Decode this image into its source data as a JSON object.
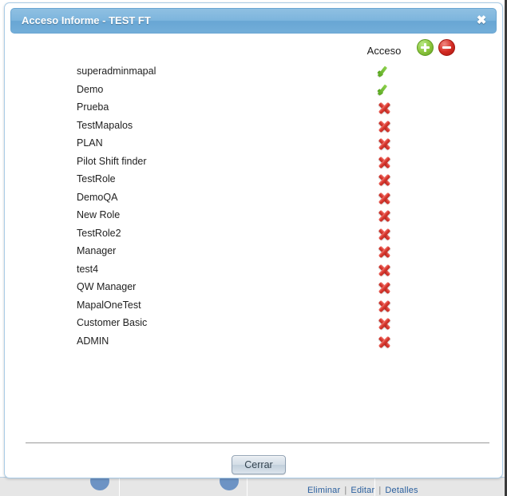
{
  "dialog": {
    "title": "Acceso Informe - TEST FT",
    "close_icon": "close-icon",
    "close_glyph": "✖"
  },
  "header": {
    "access_column_label": "Acceso",
    "add_icon": "add-circle-icon",
    "remove_icon": "remove-circle-icon"
  },
  "colors": {
    "titlebar_top": "#8fc0e2",
    "titlebar_bottom": "#73aed9",
    "dialog_border": "#a9cbe6",
    "granted_green": "#5aa820",
    "denied_red": "#dc3c33",
    "add_green": "#8dc63f",
    "remove_red": "#d42b23",
    "text": "#1f1f1f",
    "link_blue": "#2a5f9e"
  },
  "roles": [
    {
      "name": "superadminmapal",
      "access": "granted"
    },
    {
      "name": "Demo",
      "access": "granted"
    },
    {
      "name": "Prueba",
      "access": "denied"
    },
    {
      "name": "TestMapalos",
      "access": "denied"
    },
    {
      "name": "PLAN",
      "access": "denied"
    },
    {
      "name": "Pilot Shift finder",
      "access": "denied"
    },
    {
      "name": "TestRole",
      "access": "denied"
    },
    {
      "name": "DemoQA",
      "access": "denied"
    },
    {
      "name": "New Role",
      "access": "denied"
    },
    {
      "name": "TestRole2",
      "access": "denied"
    },
    {
      "name": "Manager",
      "access": "denied"
    },
    {
      "name": "test4",
      "access": "denied"
    },
    {
      "name": "QW Manager",
      "access": "denied"
    },
    {
      "name": "MapalOneTest",
      "access": "denied"
    },
    {
      "name": "Customer Basic",
      "access": "denied"
    },
    {
      "name": "ADMIN",
      "access": "denied"
    }
  ],
  "footer": {
    "close_button_label": "Cerrar"
  },
  "background": {
    "links": [
      {
        "label": "Eliminar"
      },
      {
        "label": "Editar"
      },
      {
        "label": "Detalles"
      }
    ],
    "separator": "|"
  }
}
